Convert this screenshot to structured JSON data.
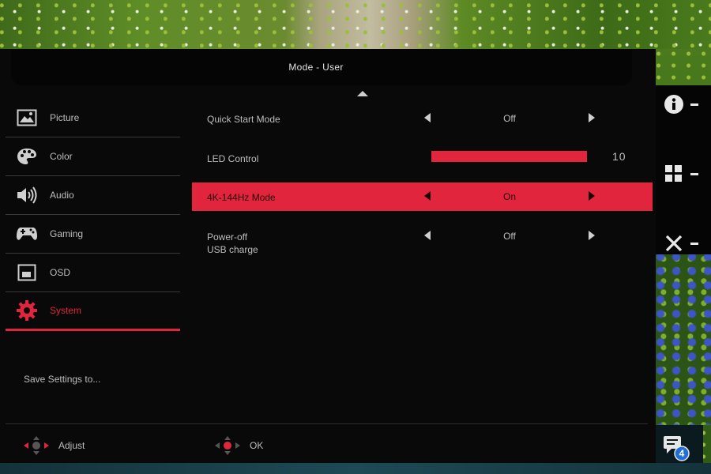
{
  "title": "Mode - User",
  "sidebar": {
    "items": [
      {
        "label": "Picture",
        "icon": "picture-icon",
        "active": false
      },
      {
        "label": "Color",
        "icon": "palette-icon",
        "active": false
      },
      {
        "label": "Audio",
        "icon": "speaker-icon",
        "active": false
      },
      {
        "label": "Gaming",
        "icon": "gamepad-icon",
        "active": false
      },
      {
        "label": "OSD",
        "icon": "osd-window-icon",
        "active": false
      },
      {
        "label": "System",
        "icon": "gear-icon",
        "active": true
      }
    ],
    "save_settings": "Save Settings to..."
  },
  "settings": [
    {
      "label": "Quick Start Mode",
      "value": "Off",
      "selected": false
    },
    {
      "label": "LED Control",
      "value": "10",
      "level_fraction": 1.0,
      "selected": false
    },
    {
      "label": "4K-144Hz Mode",
      "value": "On",
      "selected": true
    },
    {
      "label_line1": "Power-off",
      "label_line2": "USB charge",
      "value": "Off",
      "selected": false
    }
  ],
  "hints": {
    "adjust_label": "Adjust",
    "ok_label": "OK"
  },
  "function_keys": [
    {
      "icon": "info-icon"
    },
    {
      "icon": "grid-icon"
    },
    {
      "icon": "close-icon"
    }
  ],
  "notification": {
    "icon": "chat-icon",
    "count": "4"
  },
  "colors": {
    "accent": "#e0253c",
    "panel": "#0a0909",
    "text": "#bdbdbd"
  }
}
